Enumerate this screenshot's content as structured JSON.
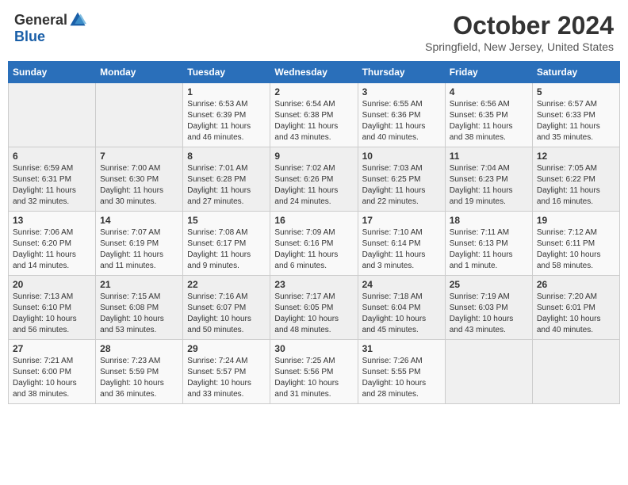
{
  "header": {
    "logo_general": "General",
    "logo_blue": "Blue",
    "month_title": "October 2024",
    "location": "Springfield, New Jersey, United States"
  },
  "days_of_week": [
    "Sunday",
    "Monday",
    "Tuesday",
    "Wednesday",
    "Thursday",
    "Friday",
    "Saturday"
  ],
  "weeks": [
    [
      {
        "day": "",
        "info": ""
      },
      {
        "day": "",
        "info": ""
      },
      {
        "day": "1",
        "info": "Sunrise: 6:53 AM\nSunset: 6:39 PM\nDaylight: 11 hours and 46 minutes."
      },
      {
        "day": "2",
        "info": "Sunrise: 6:54 AM\nSunset: 6:38 PM\nDaylight: 11 hours and 43 minutes."
      },
      {
        "day": "3",
        "info": "Sunrise: 6:55 AM\nSunset: 6:36 PM\nDaylight: 11 hours and 40 minutes."
      },
      {
        "day": "4",
        "info": "Sunrise: 6:56 AM\nSunset: 6:35 PM\nDaylight: 11 hours and 38 minutes."
      },
      {
        "day": "5",
        "info": "Sunrise: 6:57 AM\nSunset: 6:33 PM\nDaylight: 11 hours and 35 minutes."
      }
    ],
    [
      {
        "day": "6",
        "info": "Sunrise: 6:59 AM\nSunset: 6:31 PM\nDaylight: 11 hours and 32 minutes."
      },
      {
        "day": "7",
        "info": "Sunrise: 7:00 AM\nSunset: 6:30 PM\nDaylight: 11 hours and 30 minutes."
      },
      {
        "day": "8",
        "info": "Sunrise: 7:01 AM\nSunset: 6:28 PM\nDaylight: 11 hours and 27 minutes."
      },
      {
        "day": "9",
        "info": "Sunrise: 7:02 AM\nSunset: 6:26 PM\nDaylight: 11 hours and 24 minutes."
      },
      {
        "day": "10",
        "info": "Sunrise: 7:03 AM\nSunset: 6:25 PM\nDaylight: 11 hours and 22 minutes."
      },
      {
        "day": "11",
        "info": "Sunrise: 7:04 AM\nSunset: 6:23 PM\nDaylight: 11 hours and 19 minutes."
      },
      {
        "day": "12",
        "info": "Sunrise: 7:05 AM\nSunset: 6:22 PM\nDaylight: 11 hours and 16 minutes."
      }
    ],
    [
      {
        "day": "13",
        "info": "Sunrise: 7:06 AM\nSunset: 6:20 PM\nDaylight: 11 hours and 14 minutes."
      },
      {
        "day": "14",
        "info": "Sunrise: 7:07 AM\nSunset: 6:19 PM\nDaylight: 11 hours and 11 minutes."
      },
      {
        "day": "15",
        "info": "Sunrise: 7:08 AM\nSunset: 6:17 PM\nDaylight: 11 hours and 9 minutes."
      },
      {
        "day": "16",
        "info": "Sunrise: 7:09 AM\nSunset: 6:16 PM\nDaylight: 11 hours and 6 minutes."
      },
      {
        "day": "17",
        "info": "Sunrise: 7:10 AM\nSunset: 6:14 PM\nDaylight: 11 hours and 3 minutes."
      },
      {
        "day": "18",
        "info": "Sunrise: 7:11 AM\nSunset: 6:13 PM\nDaylight: 11 hours and 1 minute."
      },
      {
        "day": "19",
        "info": "Sunrise: 7:12 AM\nSunset: 6:11 PM\nDaylight: 10 hours and 58 minutes."
      }
    ],
    [
      {
        "day": "20",
        "info": "Sunrise: 7:13 AM\nSunset: 6:10 PM\nDaylight: 10 hours and 56 minutes."
      },
      {
        "day": "21",
        "info": "Sunrise: 7:15 AM\nSunset: 6:08 PM\nDaylight: 10 hours and 53 minutes."
      },
      {
        "day": "22",
        "info": "Sunrise: 7:16 AM\nSunset: 6:07 PM\nDaylight: 10 hours and 50 minutes."
      },
      {
        "day": "23",
        "info": "Sunrise: 7:17 AM\nSunset: 6:05 PM\nDaylight: 10 hours and 48 minutes."
      },
      {
        "day": "24",
        "info": "Sunrise: 7:18 AM\nSunset: 6:04 PM\nDaylight: 10 hours and 45 minutes."
      },
      {
        "day": "25",
        "info": "Sunrise: 7:19 AM\nSunset: 6:03 PM\nDaylight: 10 hours and 43 minutes."
      },
      {
        "day": "26",
        "info": "Sunrise: 7:20 AM\nSunset: 6:01 PM\nDaylight: 10 hours and 40 minutes."
      }
    ],
    [
      {
        "day": "27",
        "info": "Sunrise: 7:21 AM\nSunset: 6:00 PM\nDaylight: 10 hours and 38 minutes."
      },
      {
        "day": "28",
        "info": "Sunrise: 7:23 AM\nSunset: 5:59 PM\nDaylight: 10 hours and 36 minutes."
      },
      {
        "day": "29",
        "info": "Sunrise: 7:24 AM\nSunset: 5:57 PM\nDaylight: 10 hours and 33 minutes."
      },
      {
        "day": "30",
        "info": "Sunrise: 7:25 AM\nSunset: 5:56 PM\nDaylight: 10 hours and 31 minutes."
      },
      {
        "day": "31",
        "info": "Sunrise: 7:26 AM\nSunset: 5:55 PM\nDaylight: 10 hours and 28 minutes."
      },
      {
        "day": "",
        "info": ""
      },
      {
        "day": "",
        "info": ""
      }
    ]
  ]
}
